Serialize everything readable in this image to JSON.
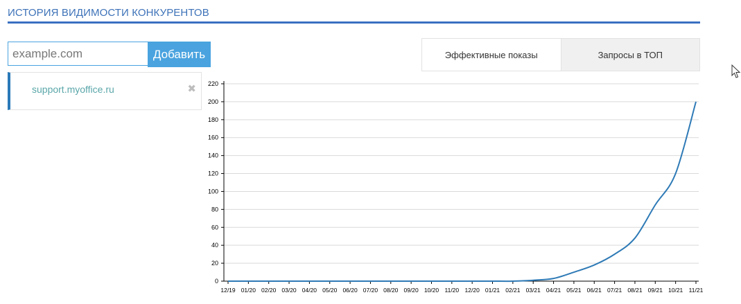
{
  "header": {
    "title": "ИСТОРИЯ ВИДИМОСТИ КОНКУРЕНТОВ"
  },
  "add_form": {
    "placeholder": "example.com",
    "button_label": "Добавить"
  },
  "sites": [
    {
      "name": "support.myoffice.ru",
      "remove_icon": "close-icon"
    }
  ],
  "tabs": [
    {
      "label": "Эффективные показы",
      "active": true
    },
    {
      "label": "Запросы в ТОП",
      "active": false
    }
  ],
  "colors": {
    "accent": "#4aa3df",
    "title": "#3d72b8",
    "line": "#2e7ab6"
  },
  "chart_data": {
    "type": "line",
    "x": [
      "12/19",
      "01/20",
      "02/20",
      "03/20",
      "04/20",
      "05/20",
      "06/20",
      "07/20",
      "08/20",
      "09/20",
      "10/20",
      "11/20",
      "12/20",
      "01/21",
      "02/21",
      "03/21",
      "04/21",
      "05/21",
      "06/21",
      "07/21",
      "08/21",
      "09/21",
      "10/21",
      "11/21"
    ],
    "series": [
      {
        "values": [
          0,
          0,
          0,
          0,
          0,
          0,
          0,
          0,
          0,
          0,
          0,
          0,
          0,
          0,
          0,
          1,
          3,
          10,
          18,
          30,
          48,
          85,
          120,
          200
        ]
      }
    ],
    "yticks": [
      0,
      20,
      40,
      60,
      80,
      100,
      120,
      140,
      160,
      180,
      200,
      220
    ],
    "ylim": [
      0,
      220
    ],
    "grid": true,
    "legend": false
  }
}
